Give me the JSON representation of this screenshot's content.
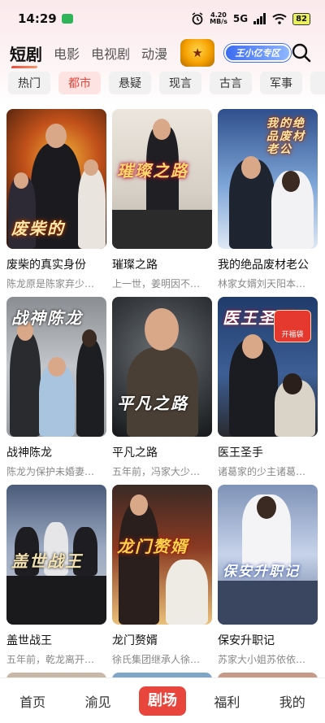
{
  "status": {
    "time": "14:29",
    "net_speed_value": "4.20",
    "net_speed_unit": "MB/s",
    "signal": "5G",
    "battery": "82"
  },
  "categories": [
    {
      "label": "短剧",
      "active": true
    },
    {
      "label": "电影",
      "active": false
    },
    {
      "label": "电视剧",
      "active": false
    },
    {
      "label": "动漫",
      "active": false
    }
  ],
  "promo_banner": "王小亿专区",
  "genres": [
    {
      "label": "热门",
      "active": false
    },
    {
      "label": "都市",
      "active": true
    },
    {
      "label": "悬疑",
      "active": false
    },
    {
      "label": "现言",
      "active": false
    },
    {
      "label": "古言",
      "active": false
    },
    {
      "label": "军事",
      "active": false
    },
    {
      "label": "玄",
      "active": false
    }
  ],
  "dramas": [
    {
      "title": "废柴的真实身份",
      "desc": "陈龙原是陈家弃少…",
      "poster_text": "废柴的",
      "colors": [
        "#3b1a0c",
        "#c2511a",
        "#f2b33a"
      ]
    },
    {
      "title": "璀璨之路",
      "desc": "上一世，姜明因不…",
      "poster_text": "璀璨之路",
      "colors": [
        "#e9e2d8",
        "#c9c0b4",
        "#2b2b2b"
      ]
    },
    {
      "title": "我的绝品废材老公",
      "desc": "林家女婿刘天阳本…",
      "poster_text": "我的绝品废材老公",
      "colors": [
        "#3a5fa0",
        "#7ea6d8",
        "#dfe8f4"
      ]
    },
    {
      "title": "战神陈龙",
      "desc": "陈龙为保护未婚妻…",
      "poster_text": "战神陈龙",
      "colors": [
        "#7c8085",
        "#b9bcc0",
        "#2c2f33"
      ]
    },
    {
      "title": "平凡之路",
      "desc": "五年前，冯家大少…",
      "poster_text": "平凡之路",
      "colors": [
        "#2a2d30",
        "#5c6166",
        "#1a1a1a"
      ]
    },
    {
      "title": "医王圣手",
      "desc": "诸葛家的少主诸葛…",
      "poster_text": "医王圣手",
      "badge": "开福袋",
      "colors": [
        "#1f3b6b",
        "#3d5f96",
        "#c9a45c"
      ]
    },
    {
      "title": "盖世战王",
      "desc": "五年前，乾龙离开…",
      "poster_text": "盖世战王",
      "colors": [
        "#3a4a6a",
        "#8a9ab5",
        "#1a1a1a"
      ]
    },
    {
      "title": "龙门赘婿",
      "desc": "徐氏集团继承人徐…",
      "poster_text": "龙门赘婿",
      "colors": [
        "#5a1a12",
        "#b5452a",
        "#e9c07a"
      ]
    },
    {
      "title": "保安升职记",
      "desc": "苏家大小姐苏依依…",
      "poster_text": "保安升职记",
      "colors": [
        "#7f93b8",
        "#c7d3ea",
        "#eef2f8"
      ]
    }
  ],
  "bottom_nav": [
    {
      "label": "首页",
      "active": false
    },
    {
      "label": "渝见",
      "active": false
    },
    {
      "label": "剧场",
      "active": true
    },
    {
      "label": "福利",
      "active": false
    },
    {
      "label": "我的",
      "active": false
    }
  ]
}
